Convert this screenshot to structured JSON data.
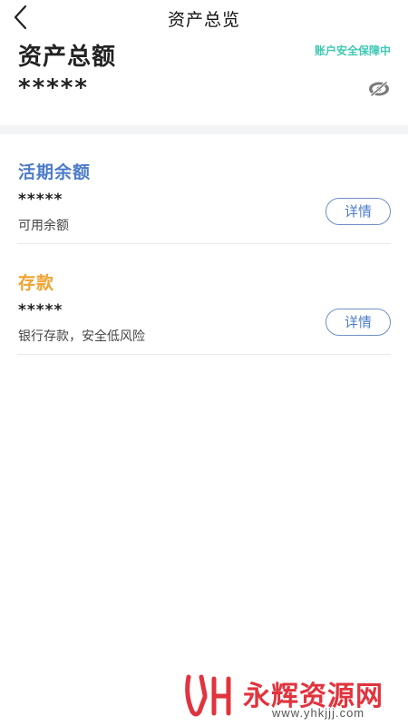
{
  "header": {
    "title": "资产总览",
    "back_icon": "chevron-left-icon"
  },
  "summary": {
    "title": "资产总额",
    "security_badge": "账户安全保障中",
    "amount_masked": "*****",
    "visibility_icon": "eye-hidden-icon"
  },
  "accounts": [
    {
      "name": "活期余额",
      "amount_masked": "*****",
      "description": "可用余额",
      "detail_label": "详情",
      "name_color": "#4d7bc9"
    },
    {
      "name": "存款",
      "amount_masked": "*****",
      "description": "银行存款，安全低风险",
      "detail_label": "详情",
      "name_color": "#f0a22e"
    }
  ],
  "watermark": {
    "name": "永辉资源网",
    "url": "www.yhkjjj.com",
    "color": "#e0343e"
  },
  "colors": {
    "accent_blue": "#4d7bc9",
    "accent_orange": "#f0a22e",
    "accent_green": "#3ec9b3",
    "section_divider": "#f3f4f6"
  }
}
